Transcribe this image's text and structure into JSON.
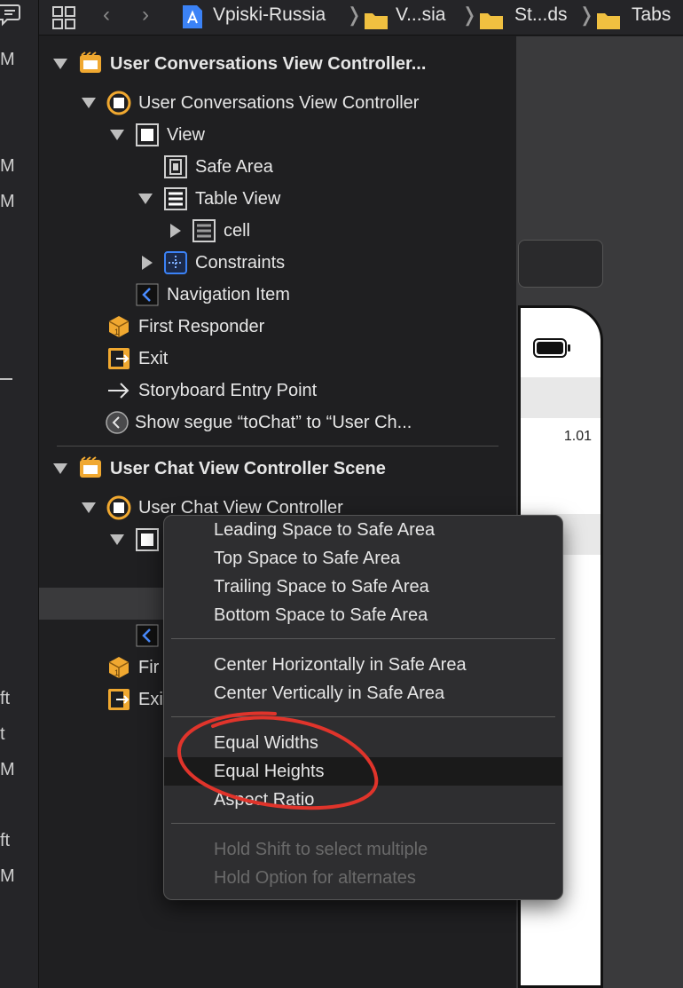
{
  "topbar": {
    "breadcrumbs": [
      "Vpiski-Russia",
      "V...sia",
      "St...ds",
      "Tabs"
    ]
  },
  "left_strip": {
    "fragments": [
      "M",
      "M",
      "M",
      "ft",
      "t",
      "M",
      "ft",
      "M"
    ]
  },
  "outline": {
    "scene1": {
      "title": "User Conversations View Controller...",
      "controller": "User Conversations View Controller",
      "view": "View",
      "safe_area": "Safe Area",
      "table_view": "Table View",
      "cell": "cell",
      "constraints": "Constraints",
      "nav_item": "Navigation Item",
      "first_responder": "First Responder",
      "exit": "Exit",
      "entry_point": "Storyboard Entry Point",
      "segue": "Show segue “toChat” to “User Ch..."
    },
    "scene2": {
      "title": "User Chat View Controller Scene",
      "controller": "User Chat View Controller",
      "first_responder": "Fir",
      "exit": "Exi"
    }
  },
  "canvas": {
    "label": "1.01"
  },
  "context_menu": {
    "items": [
      "Leading Space to Safe Area",
      "Top Space to Safe Area",
      "Trailing Space to Safe Area",
      "Bottom Space to Safe Area",
      "Center Horizontally in Safe Area",
      "Center Vertically in Safe Area",
      "Equal Widths",
      "Equal Heights",
      "Aspect Ratio",
      "Hold Shift to select multiple",
      "Hold Option for alternates"
    ],
    "highlighted": "Equal Heights"
  },
  "colors": {
    "annotation": "#e0342b",
    "controller_icon": "#f0a830",
    "constraints_icon": "#3b82f6"
  }
}
